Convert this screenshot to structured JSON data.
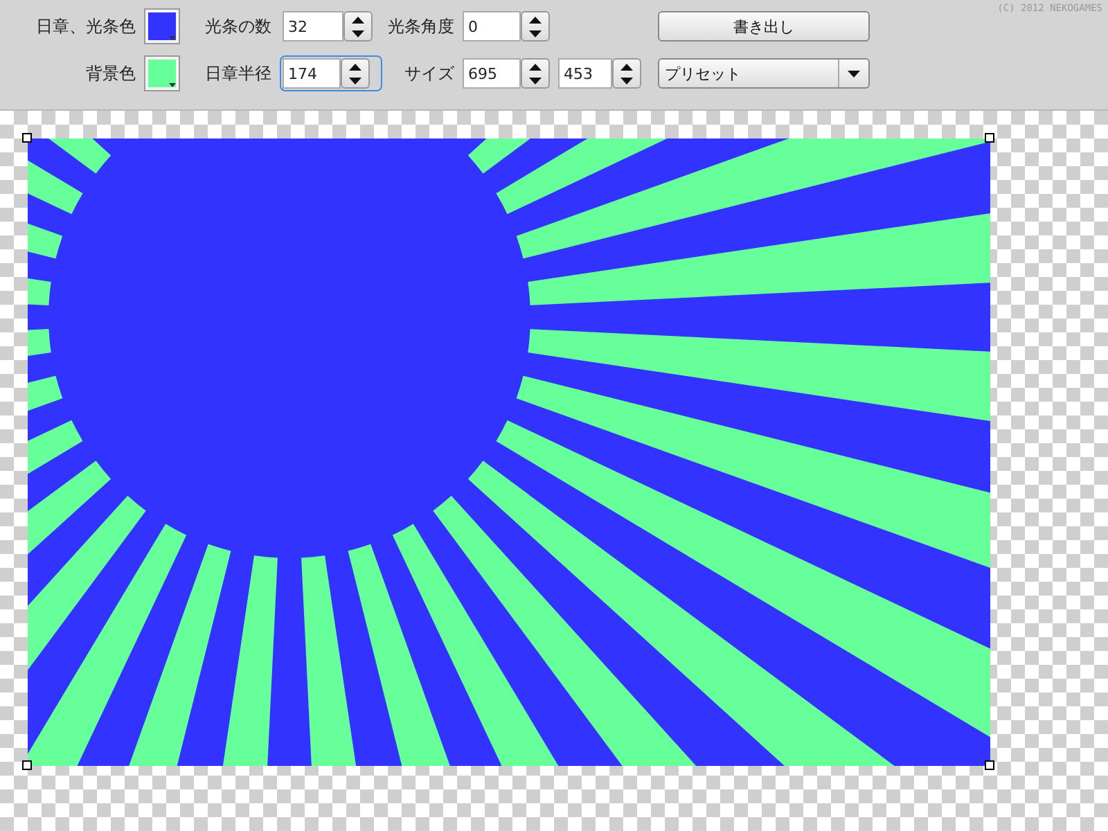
{
  "copyright": "(C) 2012 NEKOGAMES",
  "sun_ray_color": {
    "label": "日章、光条色",
    "color": "#3333ff"
  },
  "background_color": {
    "label": "背景色",
    "color": "#66ff99"
  },
  "ray_count": {
    "label": "光条の数",
    "value": "32",
    "focused": false
  },
  "ray_angle": {
    "label": "光条角度",
    "value": "0",
    "focused": false
  },
  "sun_radius": {
    "label": "日章半径",
    "value": "174",
    "focused": true
  },
  "size": {
    "label": "サイズ",
    "width": {
      "value": "695",
      "focused": false
    },
    "height": {
      "value": "453",
      "focused": false
    }
  },
  "export_button": "書き出し",
  "preset_dropdown": "プリセット"
}
